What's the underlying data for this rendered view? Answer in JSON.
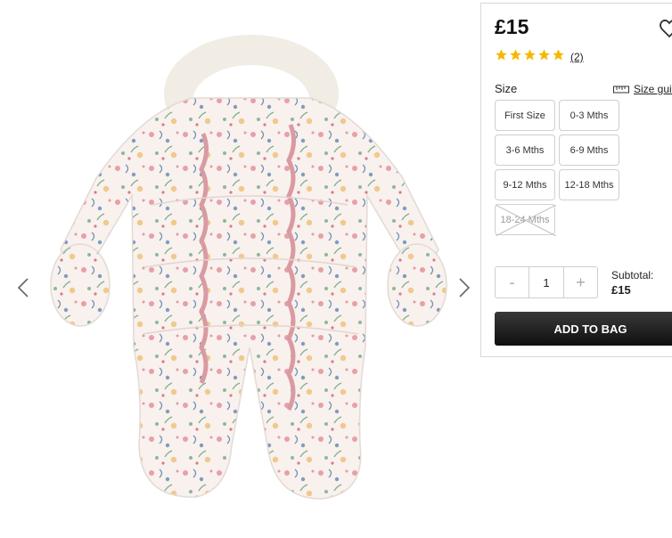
{
  "gallery": {
    "prev_icon": "chevron-left-icon",
    "next_icon": "chevron-right-icon",
    "image_subject": "floral-snowsuit-with-fur-hood-and-mittens"
  },
  "product": {
    "price": "£15",
    "wishlist_icon": "heart-icon",
    "rating": {
      "stars": 5,
      "max": 5,
      "review_count": "(2)",
      "star_color": "#f5b800"
    },
    "size_label": "Size",
    "size_guide_label": "Size guide",
    "size_guide_icon": "ruler-icon",
    "sizes": [
      {
        "label": "First Size",
        "available": true
      },
      {
        "label": "0-3 Mths",
        "available": true
      },
      {
        "label": "3-6 Mths",
        "available": true
      },
      {
        "label": "6-9 Mths",
        "available": true
      },
      {
        "label": "9-12 Mths",
        "available": true
      },
      {
        "label": "12-18 Mths",
        "available": true
      },
      {
        "label": "18-24 Mths",
        "available": false
      }
    ],
    "quantity": {
      "minus": "-",
      "value": "1",
      "plus": "+"
    },
    "subtotal_label": "Subtotal:",
    "subtotal_value": "£15",
    "add_to_bag": "ADD TO BAG",
    "add_to_bag_color": "#1a1a1a"
  }
}
